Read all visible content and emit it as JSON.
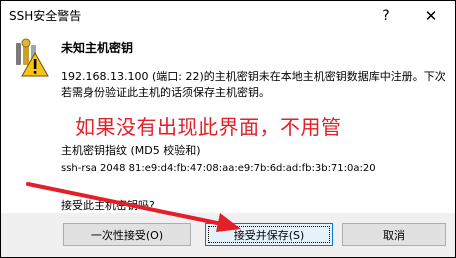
{
  "window": {
    "title": "SSH安全警告",
    "help_glyph": "?",
    "close_glyph": "✕"
  },
  "dialog": {
    "heading": "未知主机密钥",
    "message": "192.168.13.100 (端口: 22)的主机密钥未在本地主机密钥数据库中注册。下次若需身份验证此主机的话须保存主机密钥。",
    "overlay_note": "如果没有出现此界面，不用管",
    "fingerprint_label": "主机密钥指纹 (MD5 校验和)",
    "fingerprint_value": "ssh-rsa 2048 81:e9:d4:fb:47:08:aa:e9:7b:6d:ad:fb:3b:71:0a:20",
    "question": "接受此主机密钥吗?"
  },
  "buttons": {
    "accept_once": "一次性接受(O)",
    "accept_save": "接受并保存(S)",
    "cancel": "取消"
  },
  "colors": {
    "overlay": "#e3202a",
    "arrow": "#e3202a",
    "focus_border": "#0078d7"
  },
  "icons": {
    "warning": "warning-key-icon",
    "arrow": "red-arrow"
  }
}
